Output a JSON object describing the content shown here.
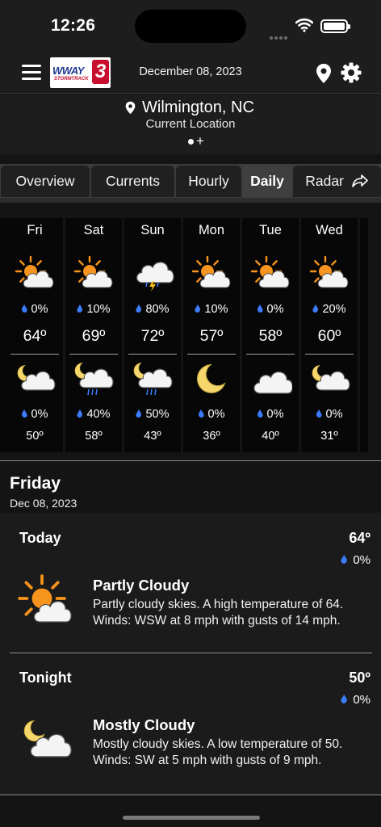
{
  "status": {
    "time": "12:26"
  },
  "header": {
    "date": "December 08, 2023",
    "logo": {
      "word": "WWAY",
      "sub": "STORMTRACK",
      "num": "3"
    }
  },
  "location": {
    "city": "Wilmington, NC",
    "label": "Current Location"
  },
  "tabs": [
    {
      "label": "Overview",
      "active": false
    },
    {
      "label": "Currents",
      "active": false
    },
    {
      "label": "Hourly",
      "active": false
    },
    {
      "label": "Daily",
      "active": true
    },
    {
      "label": "Radar",
      "active": false
    }
  ],
  "days": [
    {
      "name": "Fri",
      "day_icon": "partly-cloudy-day-icon",
      "day_pop": "0%",
      "high": "64º",
      "night_icon": "partly-cloudy-night-icon",
      "night_pop": "0%",
      "low": "50º"
    },
    {
      "name": "Sat",
      "day_icon": "partly-cloudy-day-icon",
      "day_pop": "10%",
      "high": "69º",
      "night_icon": "night-rain-icon",
      "night_pop": "40%",
      "low": "58º"
    },
    {
      "name": "Sun",
      "day_icon": "thunderstorm-icon",
      "day_pop": "80%",
      "high": "72º",
      "night_icon": "night-rain-icon",
      "night_pop": "50%",
      "low": "43º"
    },
    {
      "name": "Mon",
      "day_icon": "partly-cloudy-day-icon",
      "day_pop": "10%",
      "high": "57º",
      "night_icon": "moon-icon",
      "night_pop": "0%",
      "low": "36º"
    },
    {
      "name": "Tue",
      "day_icon": "partly-cloudy-day-icon",
      "day_pop": "0%",
      "high": "58º",
      "night_icon": "cloud-icon",
      "night_pop": "0%",
      "low": "40º"
    },
    {
      "name": "Wed",
      "day_icon": "partly-cloudy-day-icon",
      "day_pop": "20%",
      "high": "60º",
      "night_icon": "partly-cloudy-night-icon",
      "night_pop": "0%",
      "low": "31º"
    }
  ],
  "detail": {
    "day": "Friday",
    "date": "Dec 08, 2023",
    "today": {
      "label": "Today",
      "temp": "64º",
      "pop": "0%",
      "condition": "Partly Cloudy",
      "description": "Partly cloudy skies. A high temperature of 64. Winds: WSW at 8 mph with gusts of 14 mph."
    },
    "tonight": {
      "label": "Tonight",
      "temp": "50º",
      "pop": "0%",
      "condition": "Mostly Cloudy",
      "description": "Mostly cloudy skies. A low temperature of 50. Winds: SW at 5 mph with gusts of 9 mph."
    }
  },
  "colors": {
    "accent_drop": "#3c7cff",
    "sun": "#f7941d",
    "moon": "#f5d66b",
    "background": "#141414"
  }
}
